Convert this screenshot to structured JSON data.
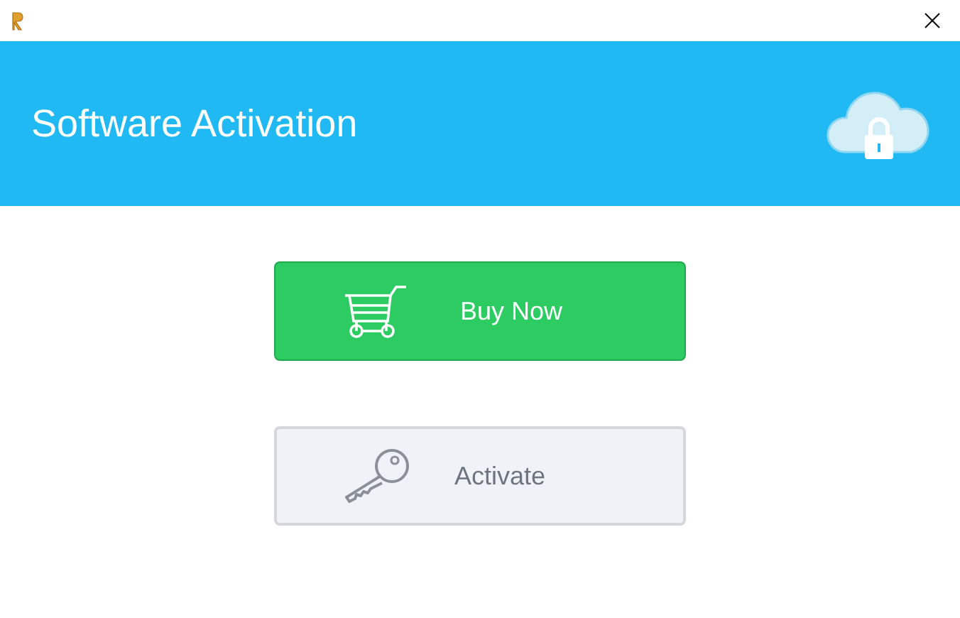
{
  "header": {
    "title": "Software Activation"
  },
  "buttons": [
    {
      "label": "Buy Now",
      "kind": "primary"
    },
    {
      "label": "Activate",
      "kind": "secondary"
    }
  ]
}
